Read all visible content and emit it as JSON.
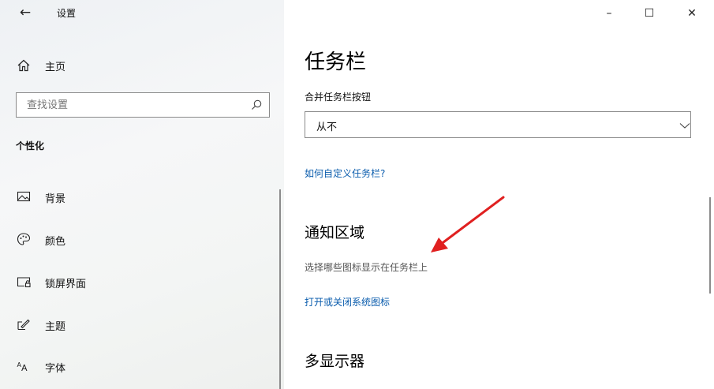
{
  "window": {
    "title": "设置",
    "back_glyph": "←",
    "minimize_glyph": "–",
    "maximize_glyph": "☐",
    "close_glyph": "✕"
  },
  "sidebar": {
    "home_label": "主页",
    "search": {
      "value": "",
      "placeholder": "查找设置"
    },
    "section_title": "个性化",
    "items": [
      {
        "label": "背景",
        "icon": "picture-icon"
      },
      {
        "label": "颜色",
        "icon": "palette-icon"
      },
      {
        "label": "锁屏界面",
        "icon": "lock-screen-icon"
      },
      {
        "label": "主题",
        "icon": "theme-brush-icon"
      },
      {
        "label": "字体",
        "icon": "font-icon"
      }
    ]
  },
  "main": {
    "title": "任务栏",
    "combine_label": "合并任务栏按钮",
    "combine_value": "从不",
    "customize_link": "如何自定义任务栏?",
    "notify_title": "通知区域",
    "notify_desc": "选择哪些图标显示在任务栏上",
    "notify_link": "打开或关闭系统图标",
    "multi_title": "多显示器"
  },
  "colors": {
    "link": "#0a5cad",
    "annotation_arrow": "#e02020"
  }
}
